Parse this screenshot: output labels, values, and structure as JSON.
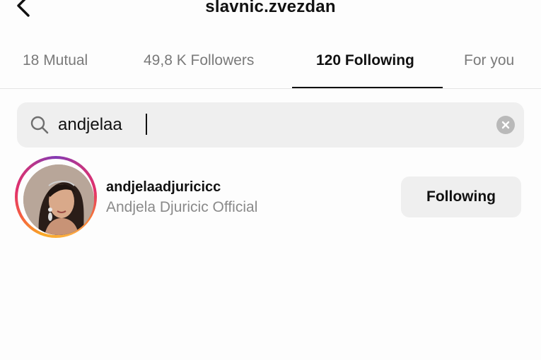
{
  "header": {
    "title": "slavnic.zvezdan",
    "back_icon": "chevron-left-icon"
  },
  "tabs": [
    {
      "label": "18 Mutual",
      "active": false
    },
    {
      "label": "49,8 K Followers",
      "active": false
    },
    {
      "label": "120 Following",
      "active": true
    },
    {
      "label": "For you",
      "active": false
    }
  ],
  "search": {
    "value": "andjelaa",
    "search_icon": "search-icon",
    "clear_icon": "clear-icon"
  },
  "results": [
    {
      "username": "andjelaadjuricicc",
      "full_name": "Andjela Djuricic Official",
      "has_story_ring": true,
      "button_label": "Following"
    }
  ],
  "colors": {
    "active_tab": "#111111",
    "inactive_tab": "#7a7a7a",
    "secondary_text": "#8a8a8a",
    "search_bg": "#efefef",
    "button_bg": "#efefef"
  }
}
